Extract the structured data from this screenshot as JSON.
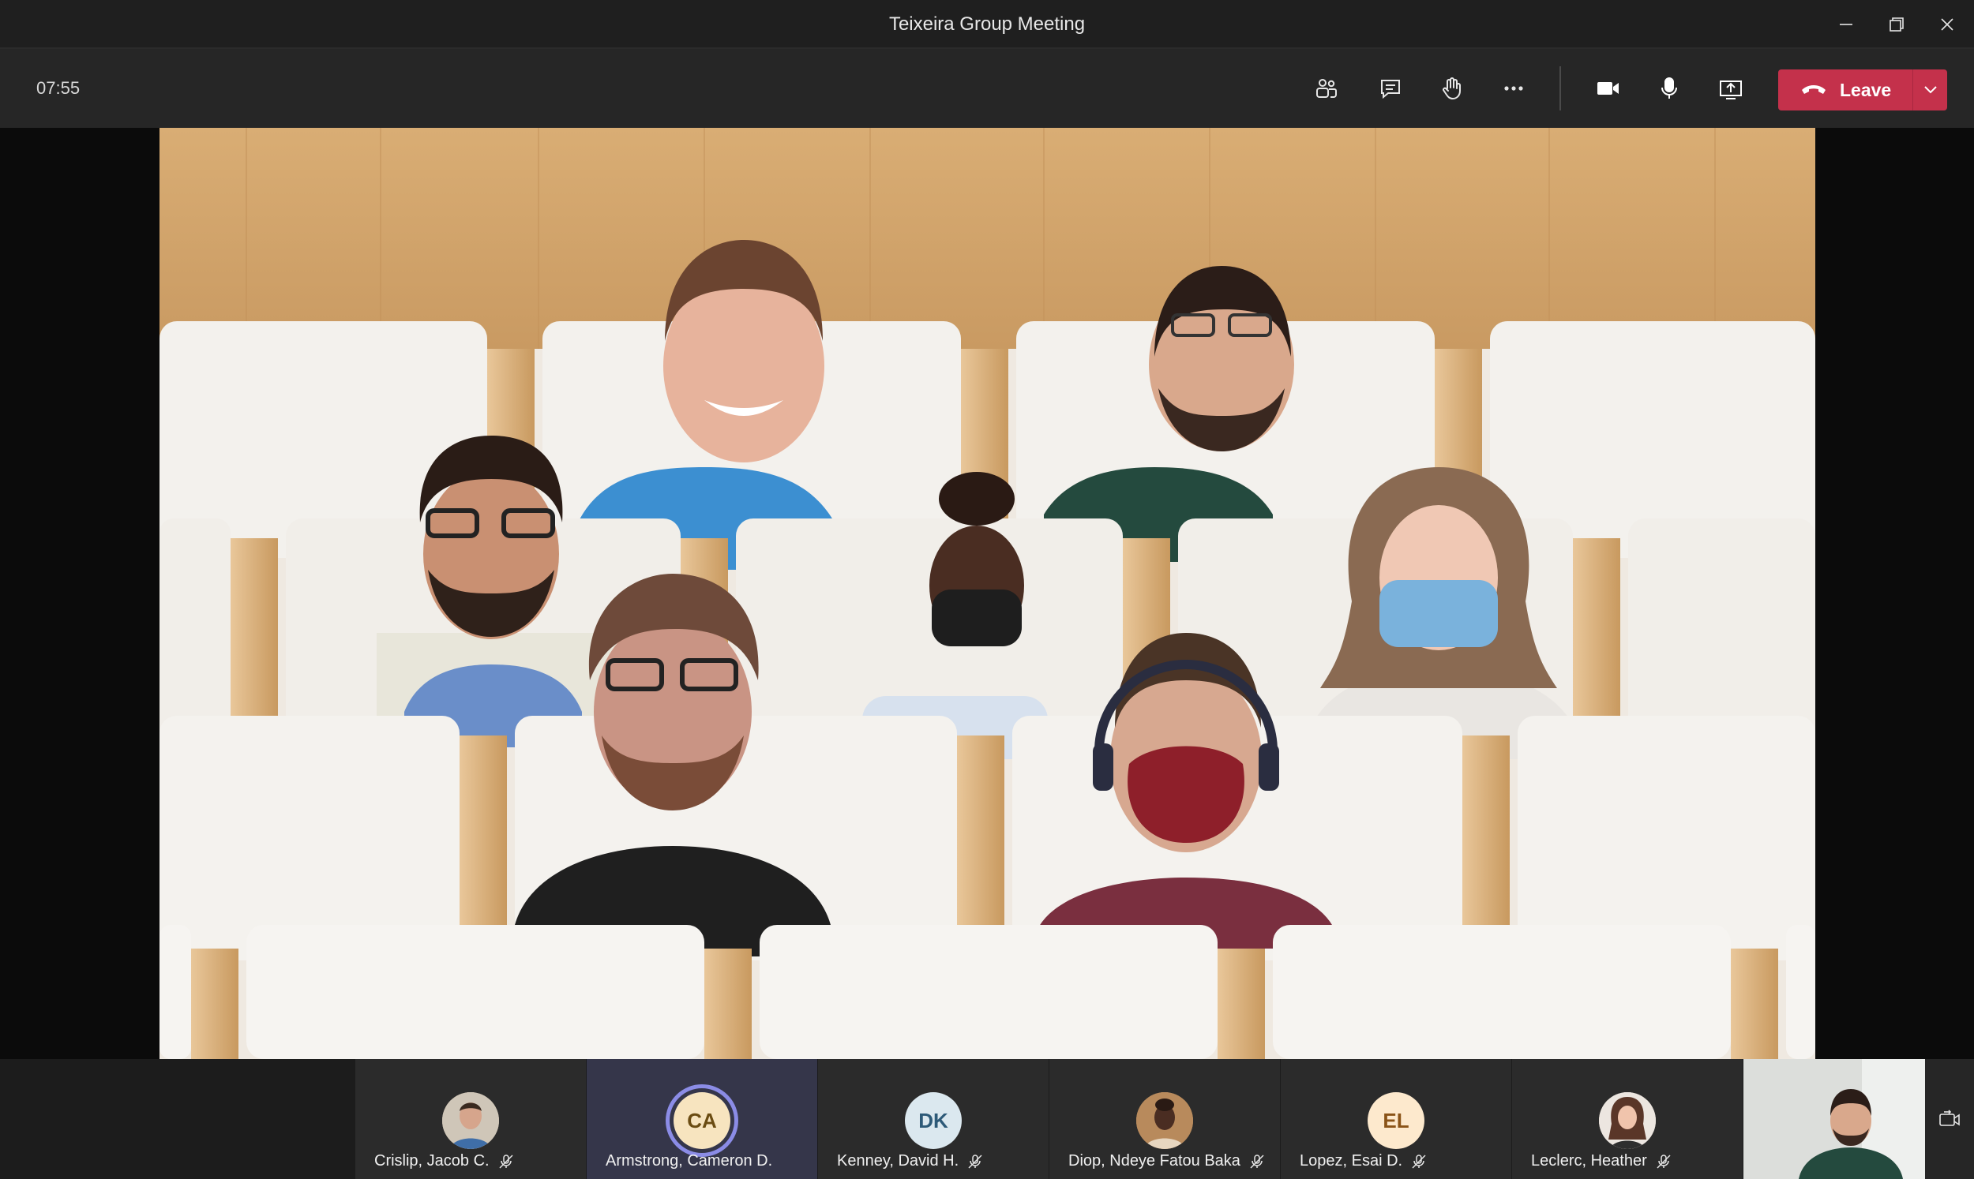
{
  "window": {
    "title": "Teixeira Group Meeting",
    "controls": [
      "minimize-icon",
      "restore-icon",
      "close-icon"
    ]
  },
  "toolbar": {
    "timer": "07:55",
    "buttons": [
      {
        "name": "participants-button",
        "icon": "people-icon"
      },
      {
        "name": "chat-button",
        "icon": "chat-icon"
      },
      {
        "name": "raise-hand-button",
        "icon": "hand-icon"
      },
      {
        "name": "more-actions-button",
        "icon": "ellipsis-icon"
      },
      {
        "name": "camera-button",
        "icon": "video-camera-icon"
      },
      {
        "name": "microphone-button",
        "icon": "microphone-icon"
      },
      {
        "name": "share-button",
        "icon": "share-screen-icon"
      }
    ],
    "leave_label": "Leave",
    "leave_color": "#c4314b"
  },
  "stage": {
    "mode": "together-mode-auditorium",
    "wall_color": "#d9ad74",
    "seat_color": "#f1eee9"
  },
  "participants": [
    {
      "name": "Crislip, Jacob C.",
      "avatar": "photo",
      "muted": true
    },
    {
      "name": "Armstrong, Cameron D.",
      "initials": "CA",
      "avatar": "initials",
      "color": "#f7e4bf",
      "text_color": "#6b4c12",
      "speaking": true,
      "muted": false
    },
    {
      "name": "Kenney, David H.",
      "initials": "DK",
      "avatar": "initials",
      "color": "#dbe8ef",
      "text_color": "#2d5a78",
      "muted": true
    },
    {
      "name": "Diop, Ndeye Fatou Baka",
      "avatar": "photo",
      "muted": true
    },
    {
      "name": "Lopez, Esai D.",
      "initials": "EL",
      "avatar": "initials",
      "color": "#fde9cd",
      "text_color": "#8a5317",
      "muted": true
    },
    {
      "name": "Leclerc, Heather",
      "avatar": "photo",
      "muted": true
    }
  ],
  "self_view": {
    "icon": "switch-camera-icon"
  }
}
